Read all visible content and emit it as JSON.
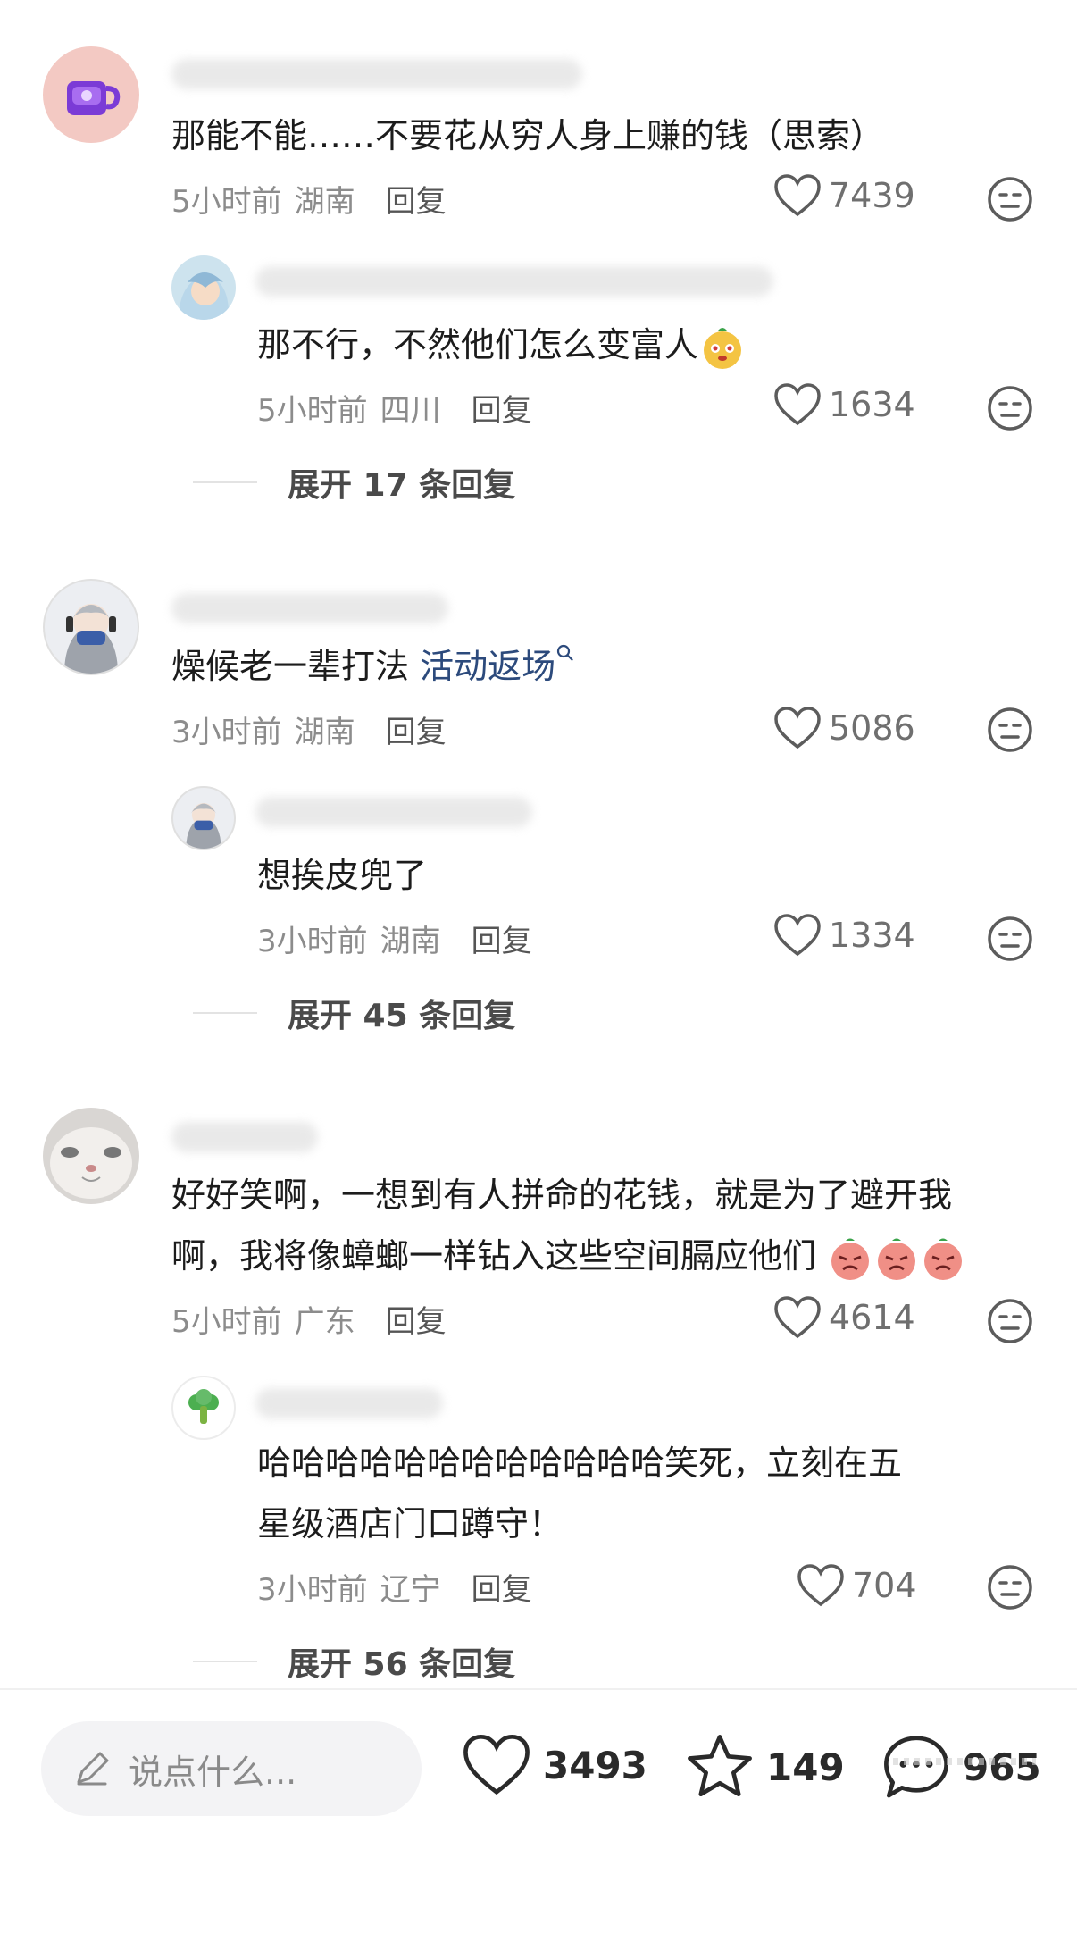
{
  "comments": [
    {
      "text": "那能不能……不要花从穷人身上赚的钱（思索）",
      "time": "5小时前",
      "location": "湖南",
      "reply_label": "回复",
      "likes": "7439",
      "replies": [
        {
          "text": "那不行，不然他们怎么变富人",
          "time": "5小时前",
          "location": "四川",
          "reply_label": "回复",
          "likes": "1634"
        }
      ],
      "expand_label": "展开 17 条回复"
    },
    {
      "text": "燥候老一辈打法 ",
      "link_text": "活动返场",
      "time": "3小时前",
      "location": "湖南",
      "reply_label": "回复",
      "likes": "5086",
      "replies": [
        {
          "text": "想挨皮兜了",
          "time": "3小时前",
          "location": "湖南",
          "reply_label": "回复",
          "likes": "1334"
        }
      ],
      "expand_label": "展开 45 条回复"
    },
    {
      "text_line1": "好好笑啊，一想到有人拼命的花钱，就是为了避开我",
      "text_line2": "啊，我将像蟑螂一样钻入这些空间膈应他们",
      "time": "5小时前",
      "location": "广东",
      "reply_label": "回复",
      "likes": "4614",
      "replies": [
        {
          "text_line1": "哈哈哈哈哈哈哈哈哈哈哈哈笑死，立刻在五",
          "text_line2": "星级酒店门口蹲守！",
          "time": "3小时前",
          "location": "辽宁",
          "reply_label": "回复",
          "likes": "704"
        }
      ],
      "expand_label": "展开 56 条回复"
    }
  ],
  "bottom_bar": {
    "input_placeholder": "说点什么...",
    "likes": "3493",
    "favorites": "149",
    "comments": "965"
  },
  "icons": {
    "like": "heart-outline-icon",
    "dislike": "neutral-face-icon",
    "favorite": "star-outline-icon",
    "comment": "chat-bubble-icon",
    "edit": "pencil-icon"
  }
}
